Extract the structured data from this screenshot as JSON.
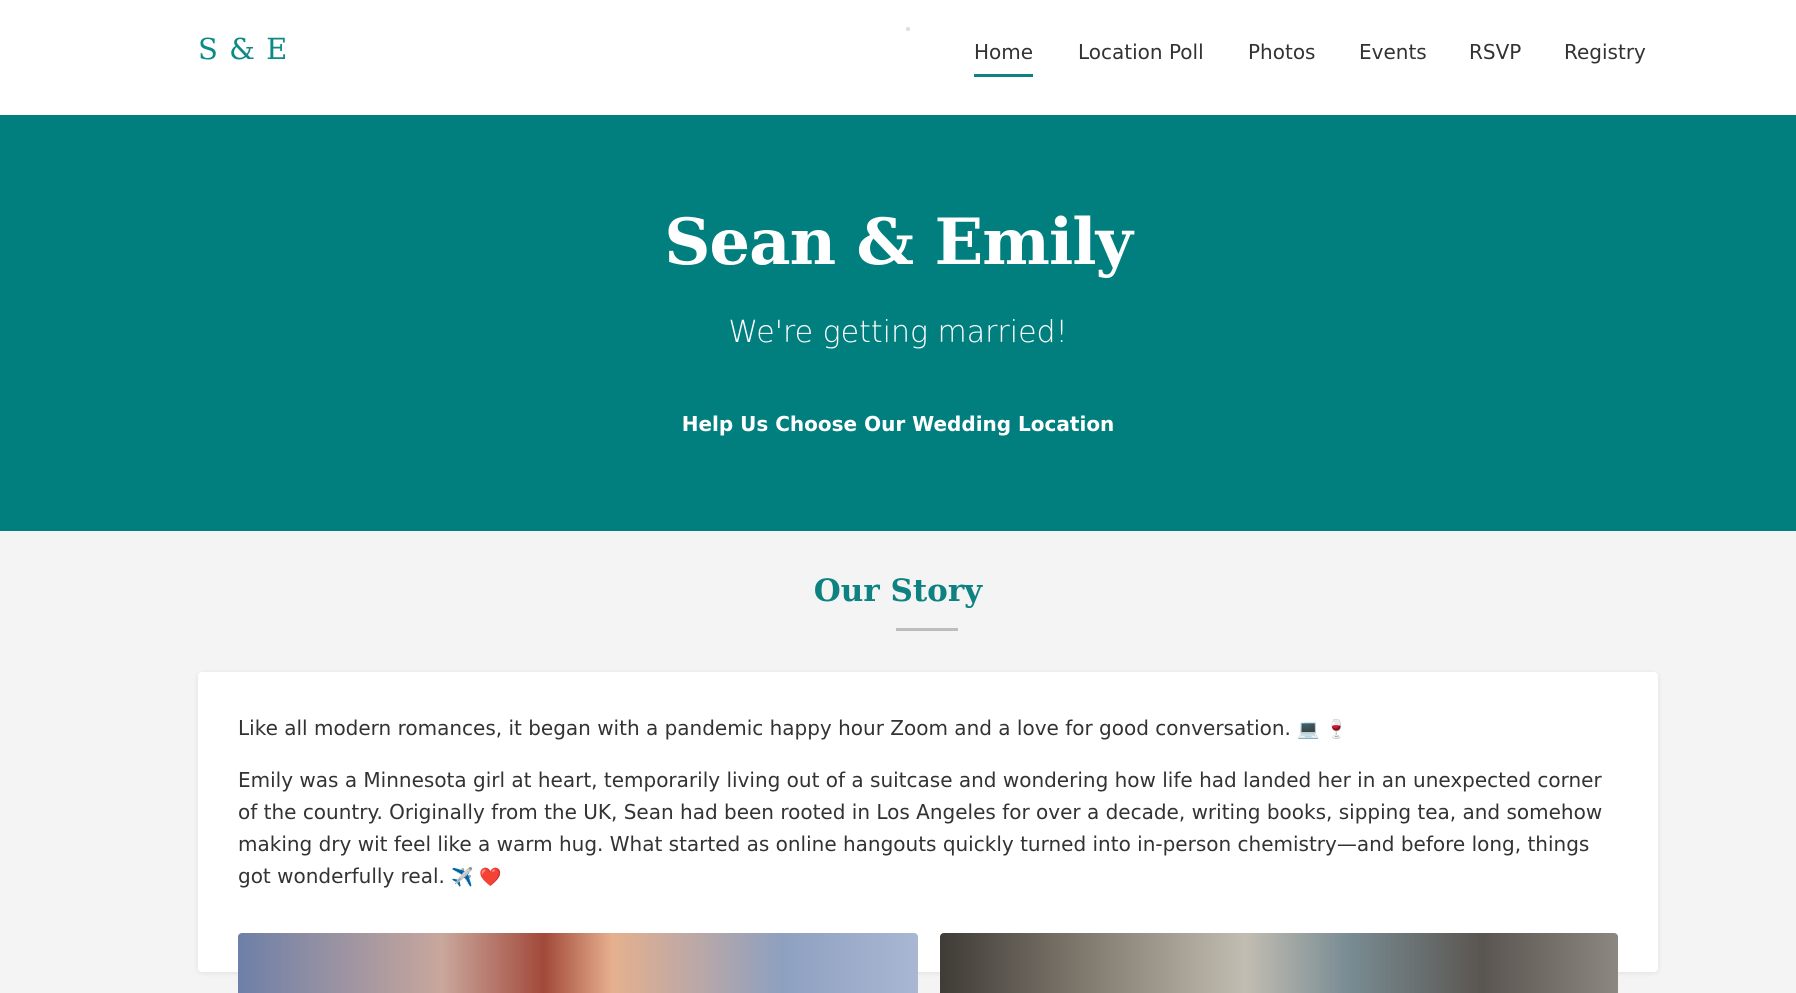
{
  "logo": "S & E",
  "nav": {
    "items": [
      {
        "label": "Home",
        "active": true
      },
      {
        "label": "Location Poll"
      },
      {
        "label": "Photos"
      },
      {
        "label": "Events"
      },
      {
        "label": "RSVP"
      },
      {
        "label": "Registry"
      }
    ]
  },
  "hero": {
    "title": "Sean & Emily",
    "subtitle": "We're getting married!",
    "cta": "Help Us Choose Our Wedding Location"
  },
  "story": {
    "title": "Our Story",
    "paragraphs": [
      "Like all modern romances, it began with a pandemic happy hour Zoom and a love for good conversation.",
      "Emily was a Minnesota girl at heart, temporarily living out of a suitcase and wondering how life had landed her in an unexpected corner of the country. Originally from the UK, Sean had been rooted in Los Angeles for over a decade, writing books, sipping tea, and somehow making dry wit feel like a warm hug. What started as online hangouts quickly turned into in-person chemistry—and before long, things got wonderfully real."
    ],
    "emojis": {
      "p1": "💻 🍷",
      "p2": "✈️ ❤️"
    }
  },
  "colors": {
    "teal": "#017f7f",
    "accent": "#0e8280",
    "page_bg": "#f4f4f4"
  }
}
